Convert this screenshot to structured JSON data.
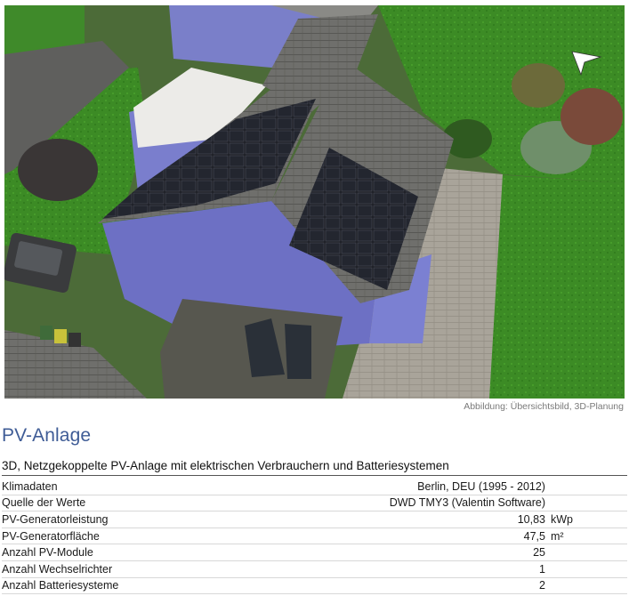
{
  "figure": {
    "caption": "Abbildung: Übersichtsbild, 3D-Planung",
    "icon": "3d-house-aerial-render"
  },
  "section": {
    "title": "PV-Anlage",
    "subtitle": "3D, Netzgekoppelte PV-Anlage mit elektrischen Verbrauchern und Batteriesystemen"
  },
  "rows": [
    {
      "label": "Klimadaten",
      "value": "Berlin, DEU (1995 - 2012)",
      "unit": ""
    },
    {
      "label": "Quelle der Werte",
      "value": "DWD TMY3 (Valentin Software)",
      "unit": ""
    },
    {
      "label": "PV-Generatorleistung",
      "value": "10,83",
      "unit": "kWp"
    },
    {
      "label": "PV-Generatorfläche",
      "value": "47,5",
      "unit": "m²"
    },
    {
      "label": "Anzahl PV-Module",
      "value": "25",
      "unit": ""
    },
    {
      "label": "Anzahl Wechselrichter",
      "value": "1",
      "unit": ""
    },
    {
      "label": "Anzahl Batteriesysteme",
      "value": "2",
      "unit": ""
    }
  ],
  "colors": {
    "title": "#3f5c96",
    "caption": "#7a7a7a"
  }
}
